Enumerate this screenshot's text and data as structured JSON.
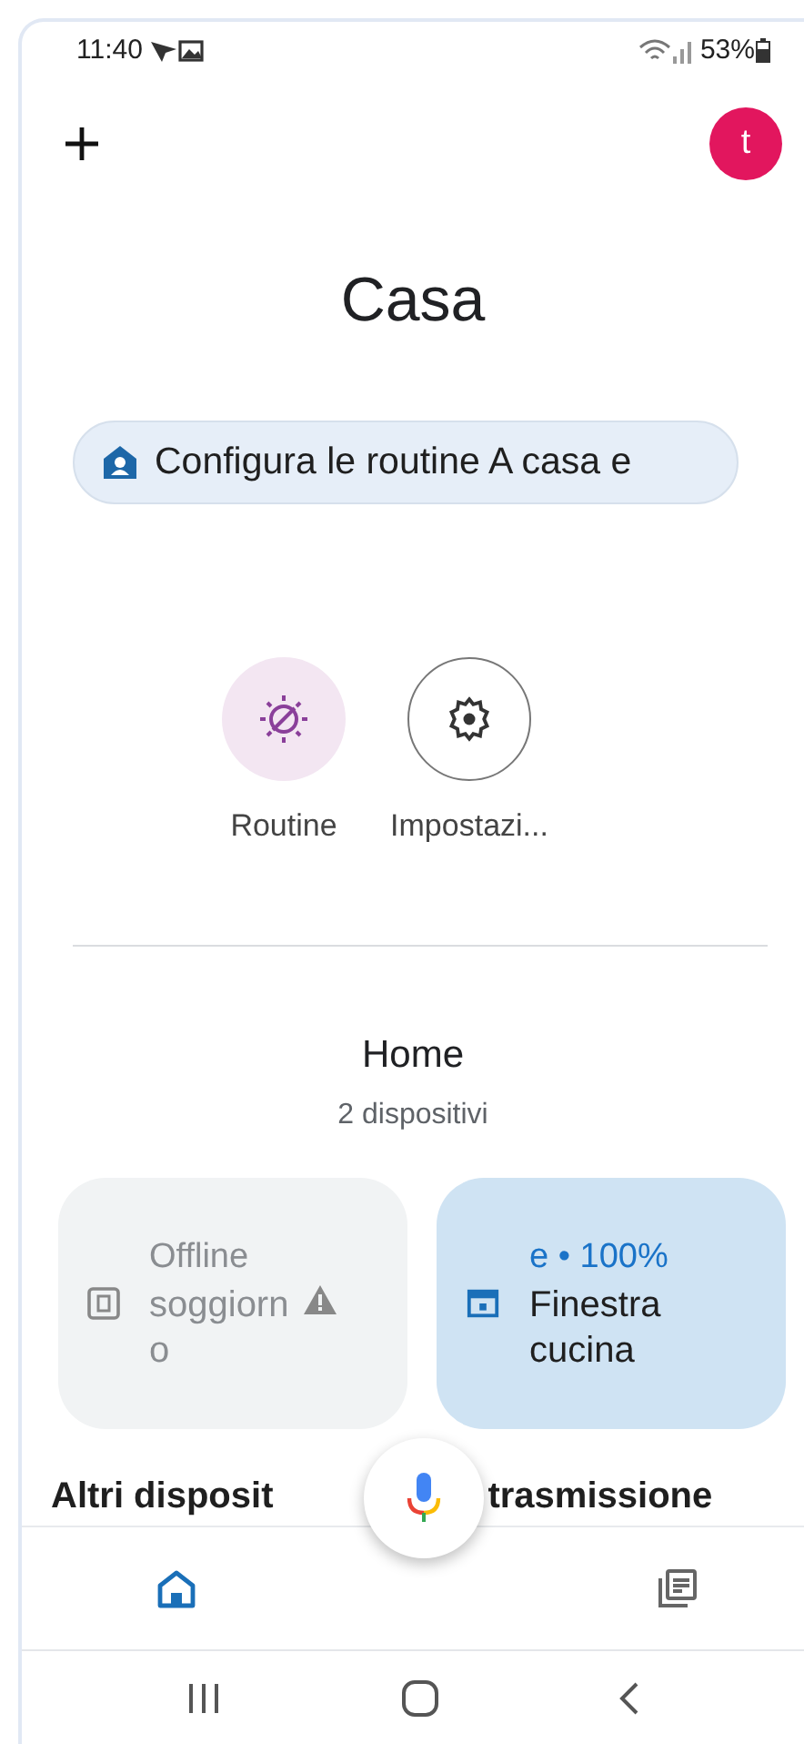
{
  "status_bar": {
    "time": "11:40",
    "battery": "53%"
  },
  "top_bar": {
    "avatar_letter": "t"
  },
  "title": "Casa",
  "banner": {
    "text": "Configura le routine A casa e"
  },
  "shortcuts": [
    {
      "kind": "routine",
      "label": "Routine"
    },
    {
      "kind": "settings",
      "label": "Impostazi..."
    }
  ],
  "home": {
    "name": "Home",
    "subtitle": "2 dispositivi"
  },
  "devices": [
    {
      "kind": "offline",
      "status": "Offline",
      "name": "soggiorno",
      "warning": true
    },
    {
      "kind": "active",
      "status": "e • 100%",
      "name": "Finestra cucina",
      "warning": false
    }
  ],
  "section_heading": [
    "Altri disposit",
    "trasmissione"
  ],
  "bottom_nav": [
    {
      "kind": "home",
      "selected": true
    },
    {
      "kind": "feed",
      "selected": false
    }
  ]
}
